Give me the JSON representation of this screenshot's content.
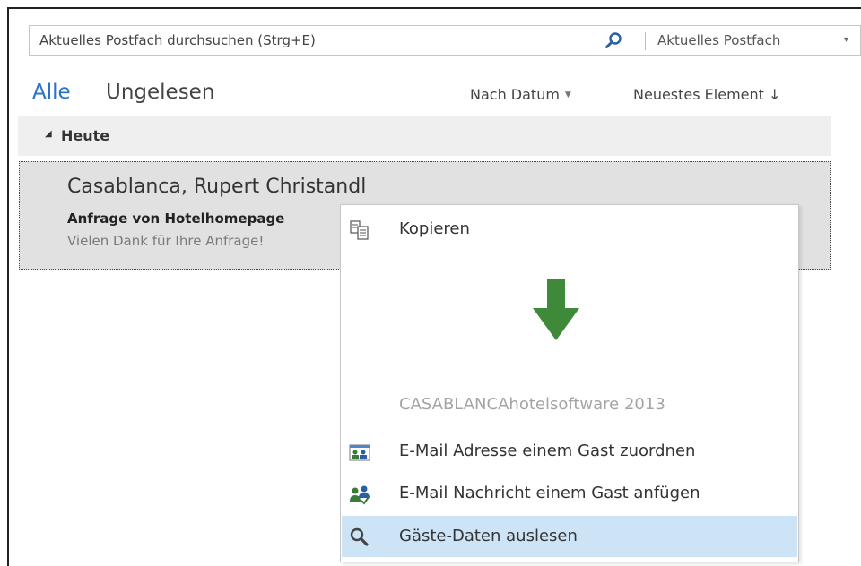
{
  "search": {
    "placeholder": "Aktuelles Postfach durchsuchen (Strg+E)",
    "scope_label": "Aktuelles Postfach",
    "scope_arrow": "▾"
  },
  "filters": {
    "all_label": "Alle",
    "unread_label": "Ungelesen",
    "sort_by_label": "Nach Datum",
    "sort_by_caret": "▼",
    "sort_order_label": "Neuestes Element ↓"
  },
  "group": {
    "toggle": "◢",
    "label": "Heute"
  },
  "message": {
    "sender": "Casablanca, Rupert Christandl",
    "subject": "Anfrage von Hotelhomepage",
    "preview": "Vielen Dank für Ihre Anfrage!"
  },
  "context_menu": {
    "copy_label": "Kopieren",
    "section_label": "CASABLANCAhotelsoftware 2013",
    "items": [
      {
        "label": "E-Mail Adresse einem Gast zuordnen",
        "icon": "contact-card-icon"
      },
      {
        "label": "E-Mail Nachricht einem Gast anfügen",
        "icon": "people-attach-icon"
      },
      {
        "label": "Gäste-Daten auslesen",
        "icon": "magnifier-icon",
        "highlighted": true
      }
    ]
  },
  "colors": {
    "accent": "#2a72c8",
    "highlight": "#cde4f7",
    "arrow_green": "#3e8a3a"
  }
}
